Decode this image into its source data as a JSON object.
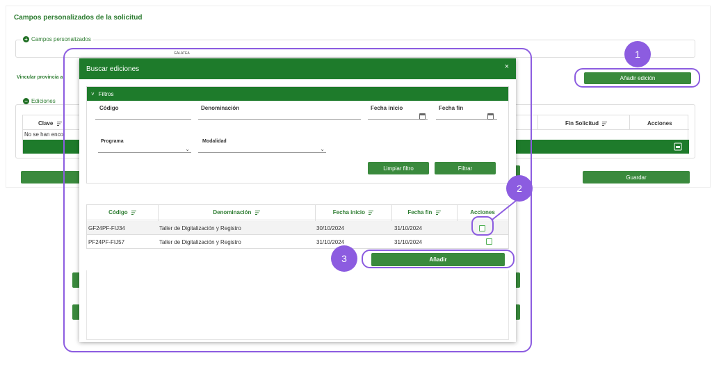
{
  "page": {
    "title": "Campos personalizados de la solicitud",
    "custom_fields_legend": "Campos personalizados",
    "vincular_label": "Vincular provincia a",
    "add_edition_button": "Añadir edición",
    "ediciones_legend": "Ediciones",
    "bg_table": {
      "col_clave": "Clave",
      "col_fin_solicitud": "Fin Solicitud",
      "col_acciones": "Acciones",
      "empty_text": "No se han enco"
    },
    "save_button": "Guardar",
    "logo_text": "GALATEA"
  },
  "modal": {
    "title": "Buscar ediciones",
    "close": "×",
    "filters_title": "Filtros",
    "fields": {
      "codigo": "Código",
      "denominacion": "Denominación",
      "fecha_inicio": "Fecha inicio",
      "fecha_fin": "Fecha fin",
      "programa": "Programa",
      "modalidad": "Modalidad"
    },
    "clear_button": "Limpiar filtro",
    "filter_button": "Filtrar",
    "results": {
      "headers": [
        "Código",
        "Denominación",
        "Fecha inicio",
        "Fecha fin",
        "Acciones"
      ],
      "rows": [
        {
          "codigo": "GF24PF-FIJ34",
          "denominacion": "Taller de Digitalización y Registro",
          "inicio": "30/10/2024",
          "fin": "31/10/2024"
        },
        {
          "codigo": "PF24PF-FIJ57",
          "denominacion": "Taller de Digitalización y Registro",
          "inicio": "31/10/2024",
          "fin": "31/10/2024"
        }
      ]
    },
    "add_button": "Añadir"
  },
  "annotations": [
    "1",
    "2",
    "3"
  ],
  "colors": {
    "accent_green": "#1e7b2b",
    "button_green": "#3a8a3d",
    "annotation_purple": "#8c5ce0"
  }
}
